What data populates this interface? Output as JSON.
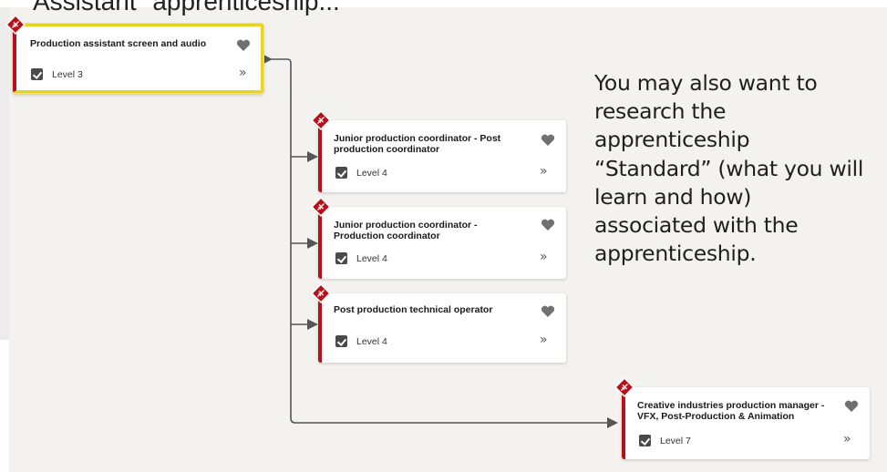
{
  "header": {
    "title": "Assistant\" apprenticeship..."
  },
  "side_note": {
    "text": "You may also want to research the apprenticeship “Standard” (what you will learn and how) associated with the apprenticeship."
  },
  "cards": [
    {
      "title": "Production assistant screen and audio",
      "level": "Level 3",
      "highlighted": true
    },
    {
      "title": "Junior production coordinator - Post production coordinator",
      "level": "Level 4"
    },
    {
      "title": "Junior production coordinator - Production coordinator",
      "level": "Level 4"
    },
    {
      "title": "Post production technical operator",
      "level": "Level 4"
    },
    {
      "title": "Creative industries production manager - VFX, Post-Production & Animation",
      "level": "Level 7"
    }
  ],
  "icons": {
    "badge": "apprenticeship-badge-icon",
    "favourite": "heart-icon",
    "level": "checked-clipboard-icon",
    "more": "double-chevron-right-icon"
  },
  "colors": {
    "accent": "#b5121b",
    "highlight": "#e8d324",
    "background": "#f3f2ee"
  }
}
